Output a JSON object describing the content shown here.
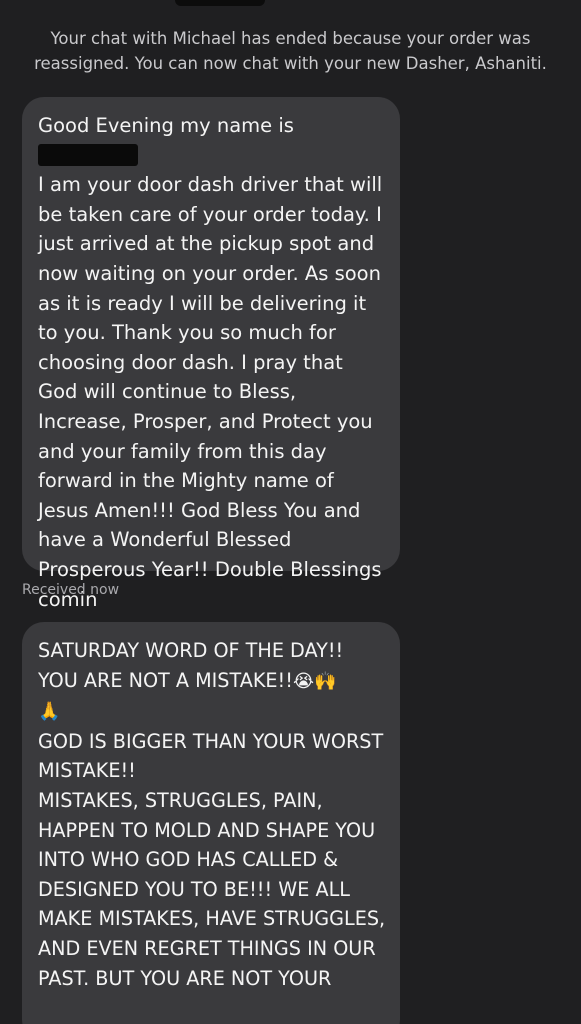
{
  "system_notice": "Your chat with Michael has ended because your order was reassigned. You can now chat with your new Dasher, Ashaniti.",
  "messages": [
    {
      "text_before_redaction": "Good Evening my name is ",
      "text_after_redaction": "\nI am your door dash driver that will be taken care of your order today. I just arrived at the pickup spot and now waiting on your order. As soon as it is ready I will be delivering it to you. Thank you so much for choosing door dash. I pray that God will continue to Bless, Increase, Prosper, and Protect you and your family from this day forward in the Mighty name of Jesus Amen!!! God Bless You and have a Wonderful Blessed Prosperous Year!! Double Blessings comin"
    },
    {
      "line1": "SATURDAY WORD OF THE DAY!!",
      "line2": "YOU ARE NOT A MISTAKE!!",
      "emojis": "😭🙌",
      "pray_emoji": "🙏",
      "body": "GOD IS BIGGER THAN YOUR WORST MISTAKE!!\nMISTAKES, STRUGGLES, PAIN, HAPPEN TO MOLD AND SHAPE YOU INTO WHO GOD HAS CALLED & DESIGNED YOU TO BE!!! WE ALL MAKE MISTAKES, HAVE STRUGGLES, AND EVEN REGRET THINGS IN OUR PAST. BUT YOU ARE NOT YOUR"
    }
  ],
  "timestamp": "Received now",
  "colors": {
    "background": "#1f1f21",
    "bubble": "#3a3a3d",
    "text": "#f4f4f4",
    "muted": "#a9a9ad"
  }
}
